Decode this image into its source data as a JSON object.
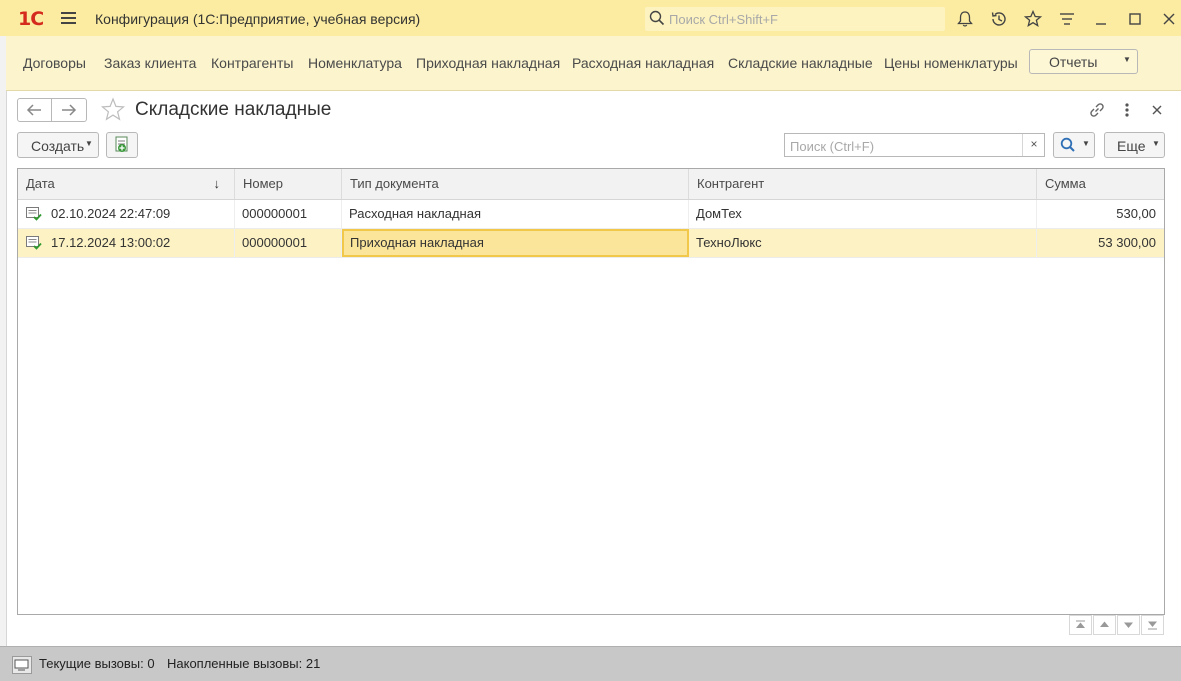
{
  "app": {
    "logo": "1С",
    "title": "Конфигурация  (1С:Предприятие, учебная версия)",
    "search_placeholder": "Поиск Ctrl+Shift+F"
  },
  "sections": {
    "items": [
      {
        "label": "Договоры"
      },
      {
        "label": "Заказ клиента"
      },
      {
        "label": "Контрагенты"
      },
      {
        "label": "Номенклатура"
      },
      {
        "label": "Приходная накладная"
      },
      {
        "label": "Расходная накладная"
      },
      {
        "label": "Складские накладные"
      },
      {
        "label": "Цены номенклатуры"
      }
    ],
    "reports_label": "Отчеты"
  },
  "form": {
    "title": "Складские накладные",
    "create_label": "Создать",
    "search_placeholder": "Поиск (Ctrl+F)",
    "search_clear": "×",
    "more_label": "Еще"
  },
  "table": {
    "columns": [
      "Дата",
      "Номер",
      "Тип документа",
      "Контрагент",
      "Сумма"
    ],
    "sort_indicator": "↓",
    "rows": [
      {
        "date": "02.10.2024 22:47:09",
        "number": "000000001",
        "doc_type": "Расходная накладная",
        "counterparty": "ДомТех",
        "amount": "530,00"
      },
      {
        "date": "17.12.2024 13:00:02",
        "number": "000000001",
        "doc_type": "Приходная накладная",
        "counterparty": "ТехноЛюкс",
        "amount": "53 300,00"
      }
    ],
    "selected_row": 1
  },
  "status": {
    "current_calls": "Текущие вызовы: 0",
    "accumulated_calls": "Накопленные вызовы: 21"
  },
  "colors": {
    "titlebar": "#fbeca1",
    "sections_bar": "#fbf4cd",
    "selected_row": "#fdf2c4",
    "current_cell": "#fbe59b",
    "logo": "#d52b1e"
  }
}
